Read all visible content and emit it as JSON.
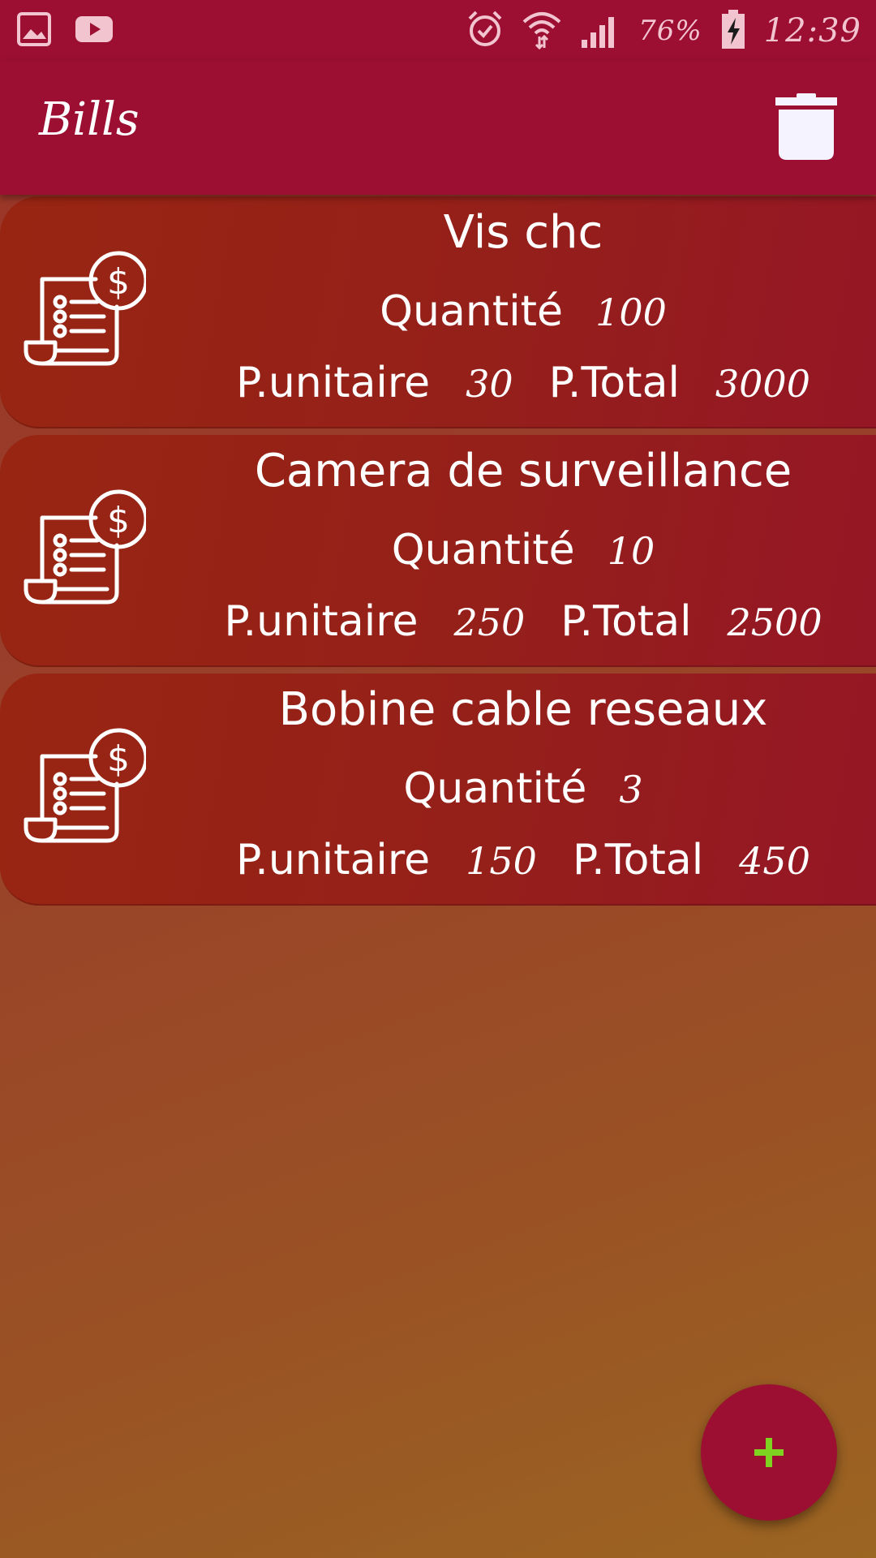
{
  "status_bar": {
    "left_icons": [
      "gallery-icon",
      "youtube-icon"
    ],
    "right_icons": [
      "alarm-icon",
      "wifi-icon",
      "cell-signal-icon",
      "battery-charging-icon"
    ],
    "battery": "76%",
    "time": "12:39"
  },
  "app_bar": {
    "title": "Bills",
    "action_icon": "trash-icon"
  },
  "bills": [
    {
      "name": "Vis chc",
      "quantity_label": "Quantité",
      "quantity": "100",
      "unit_price_label": "P.unitaire",
      "unit_price": "30",
      "total_label": "P.Total",
      "total": "3000"
    },
    {
      "name": "Camera de surveillance",
      "quantity_label": "Quantité",
      "quantity": "10",
      "unit_price_label": "P.unitaire",
      "unit_price": "250",
      "total_label": "P.Total",
      "total": "2500"
    },
    {
      "name": "Bobine cable reseaux",
      "quantity_label": "Quantité",
      "quantity": "3",
      "unit_price_label": "P.unitaire",
      "unit_price": "150",
      "total_label": "P.Total",
      "total": "450"
    }
  ],
  "fab": {
    "icon": "plus-icon",
    "icon_color": "#7ed321"
  },
  "colors": {
    "primary": "#9c0f33",
    "card": "#96201a",
    "text": "#ffffff"
  }
}
